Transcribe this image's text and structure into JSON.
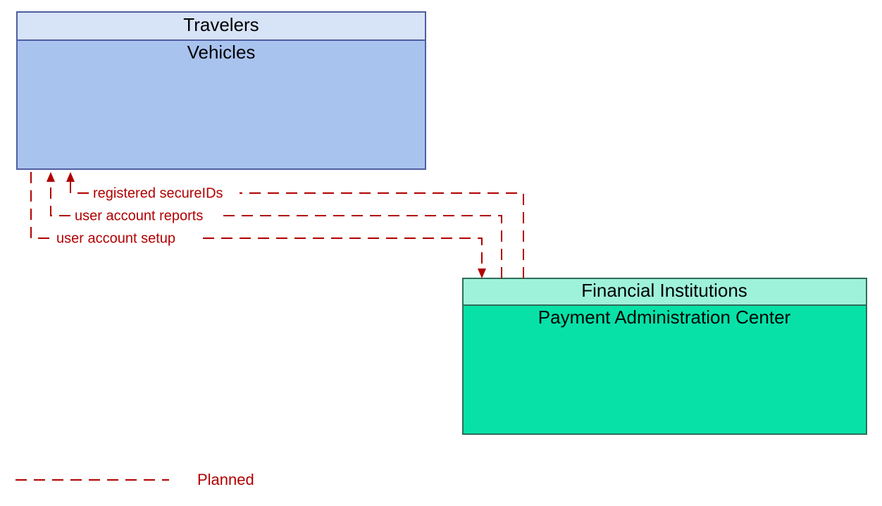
{
  "nodes": {
    "travelers": {
      "header": "Travelers",
      "sub": "Vehicles"
    },
    "financial": {
      "header": "Financial Institutions",
      "sub": "Payment Administration Center"
    }
  },
  "flows": {
    "registered_secure_ids": "registered secureIDs",
    "user_account_reports": "user account reports",
    "user_account_setup": "user account setup"
  },
  "legend": {
    "planned": "Planned"
  },
  "colors": {
    "travelers_header_fill": "#d7e3f7",
    "travelers_body_fill": "#a9c3ef",
    "travelers_stroke": "#4f5ea0",
    "financial_header_fill": "#9ef2d9",
    "financial_body_fill": "#07e1a8",
    "financial_stroke": "#2f6d5b",
    "flow_stroke": "#b10000"
  }
}
